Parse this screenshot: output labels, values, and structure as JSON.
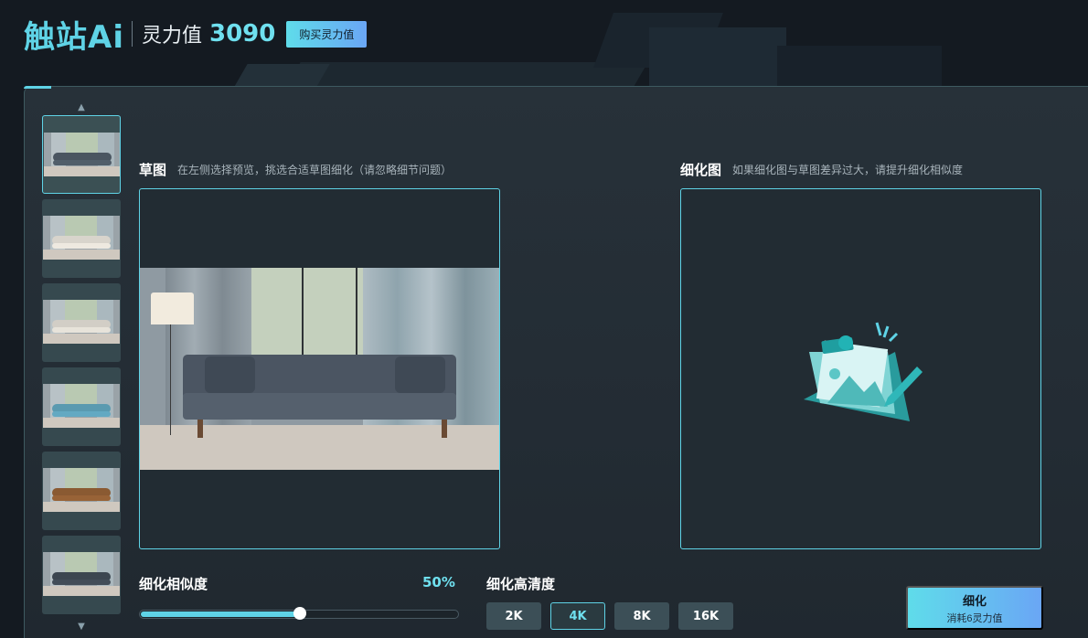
{
  "header": {
    "logo": "触站Ai",
    "points_label": "灵力值",
    "points_value": "3090",
    "buy_button": "购买灵力值"
  },
  "sketch": {
    "title": "草图",
    "hint": "在左侧选择预览，挑选合适草图细化（请忽略细节问题）"
  },
  "refined": {
    "title": "细化图",
    "hint": "如果细化图与草图差异过大，请提升细化相似度"
  },
  "similarity": {
    "label": "细化相似度",
    "value_text": "50%",
    "value": 50
  },
  "resolution": {
    "label": "细化高清度",
    "options": [
      "2K",
      "4K",
      "8K",
      "16K"
    ],
    "selected": "4K"
  },
  "refine_button": {
    "label": "细化",
    "cost": "消耗6灵力值"
  },
  "thumbnails": [
    {
      "sofa": "#4a5560",
      "active": true
    },
    {
      "sofa": "#d8d4cc",
      "active": false
    },
    {
      "sofa": "#d2cec6",
      "active": false
    },
    {
      "sofa": "#5a9ab0",
      "active": false
    },
    {
      "sofa": "#8a5a32",
      "active": false
    },
    {
      "sofa": "#3c4650",
      "active": false
    }
  ],
  "colors": {
    "accent": "#5fd3e6",
    "accent_text": "#6fe0ef"
  },
  "icons": {
    "scroll_up": "chevron-up-icon",
    "scroll_down": "chevron-down-icon",
    "placeholder": "image-placeholder-icon"
  }
}
